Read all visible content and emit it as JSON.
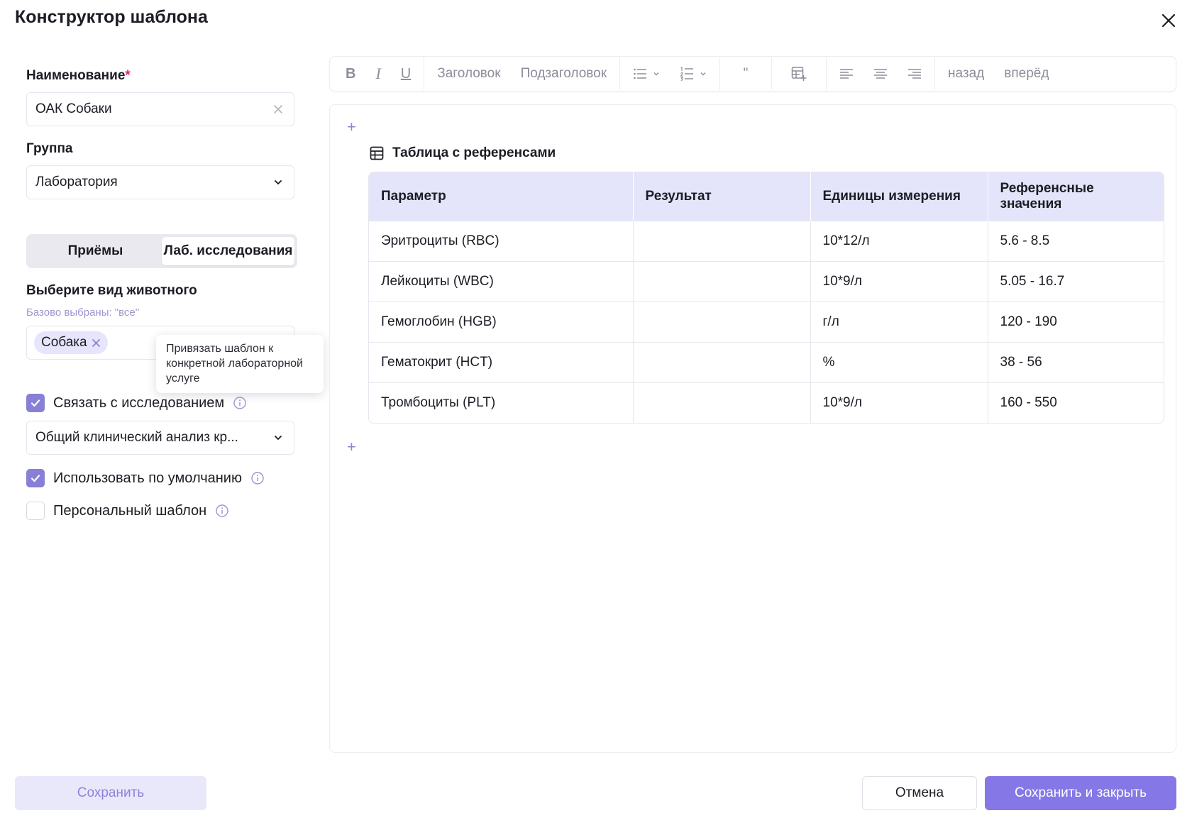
{
  "modal": {
    "title": "Конструктор шаблона"
  },
  "left": {
    "name": {
      "label": "Наименование",
      "required_mark": "*",
      "value": "ОАК Собаки"
    },
    "group": {
      "label": "Группа",
      "value": "Лаборатория"
    },
    "tabs": [
      {
        "label": "Приёмы",
        "active": false
      },
      {
        "label": "Лаб. исследования",
        "active": true
      }
    ],
    "animal": {
      "label": "Выберите вид животного",
      "hint": "Базово выбраны: \"все\"",
      "tags": [
        "Собака"
      ]
    },
    "tooltip": "Привязать шаблон к конкретной лабораторной услуге",
    "link_study": {
      "label": "Связать с исследованием",
      "checked": true
    },
    "study": {
      "value": "Общий клинический анализ кр..."
    },
    "use_default": {
      "label": "Использовать по умолчанию",
      "checked": true
    },
    "personal": {
      "label": "Персональный шаблон",
      "checked": false
    }
  },
  "toolbar": {
    "bold": "B",
    "italic": "I",
    "underline": "U",
    "heading": "Заголовок",
    "subheading": "Подзаголовок",
    "quote": "\"",
    "undo": "назад",
    "redo": "вперёд"
  },
  "editor": {
    "table_title": "Таблица с референсами",
    "columns": [
      "Параметр",
      "Результат",
      "Единицы измерения",
      "Референсные значения"
    ],
    "rows": [
      [
        "Эритроциты (RBC)",
        "",
        "10*12/л",
        "5.6 - 8.5"
      ],
      [
        "Лейкоциты (WBC)",
        "",
        "10*9/л",
        "5.05 - 16.7"
      ],
      [
        "Гемоглобин (HGB)",
        "",
        "г/л",
        "120 - 190"
      ],
      [
        "Гематокрит (HCT)",
        "",
        "%",
        "38 - 56"
      ],
      [
        "Тромбоциты (PLT)",
        "",
        "10*9/л",
        "160 - 550"
      ]
    ]
  },
  "footer": {
    "save": "Сохранить",
    "cancel": "Отмена",
    "save_close": "Сохранить и закрыть"
  },
  "colors": {
    "accent": "#8577e6",
    "header_bg": "#e4e4fa",
    "checkbox": "#8880d6"
  }
}
